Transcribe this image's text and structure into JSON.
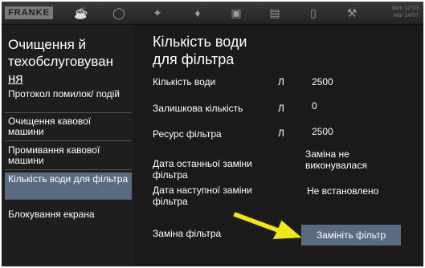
{
  "topbar": {
    "logo": "FRANKE",
    "icons": [
      "coffee-icon",
      "milk-icon",
      "cleaning-icon",
      "water-drop-icon",
      "cup-icon",
      "statistics-icon",
      "document-icon",
      "wrench-icon"
    ],
    "clock_line1": "Mon 12:03",
    "clock_line2": "Mar 14/07"
  },
  "sidebar": {
    "title_lines": [
      "Очищення й",
      "техобслуговуван",
      "ня"
    ],
    "items": [
      {
        "label": "Протокол помилок/ подій"
      },
      {
        "label": "Очищення кавової машини"
      },
      {
        "label": "Промивання кавової машини"
      },
      {
        "label": "Кількість води для фільтра"
      },
      {
        "label": "Блокування екрана"
      }
    ]
  },
  "main": {
    "title_lines": [
      "Кількість води",
      "для фільтра"
    ],
    "rows": [
      {
        "label": "Кількість води",
        "unit": "Л",
        "value": "2500"
      },
      {
        "label": "Залишкова кількість",
        "unit": "Л",
        "value": "0"
      },
      {
        "label": "Ресурс фільтра",
        "unit": "Л",
        "value": "2500"
      }
    ],
    "last_change_label_1": "Дата останньої заміни",
    "last_change_label_2": "фільтра",
    "last_change_value_1": "Заміна не",
    "last_change_value_2": "виконувалася",
    "next_change_label_1": "Дата наступної заміни",
    "next_change_label_2": "фільтра",
    "next_change_value": "Не встановлено",
    "replace_label": "Заміна фільтра",
    "replace_button": "Замініть фільтр"
  },
  "colors": {
    "accent": "#5a6a80",
    "arrow": "#f0e81a",
    "background": "#1a1a1a"
  }
}
